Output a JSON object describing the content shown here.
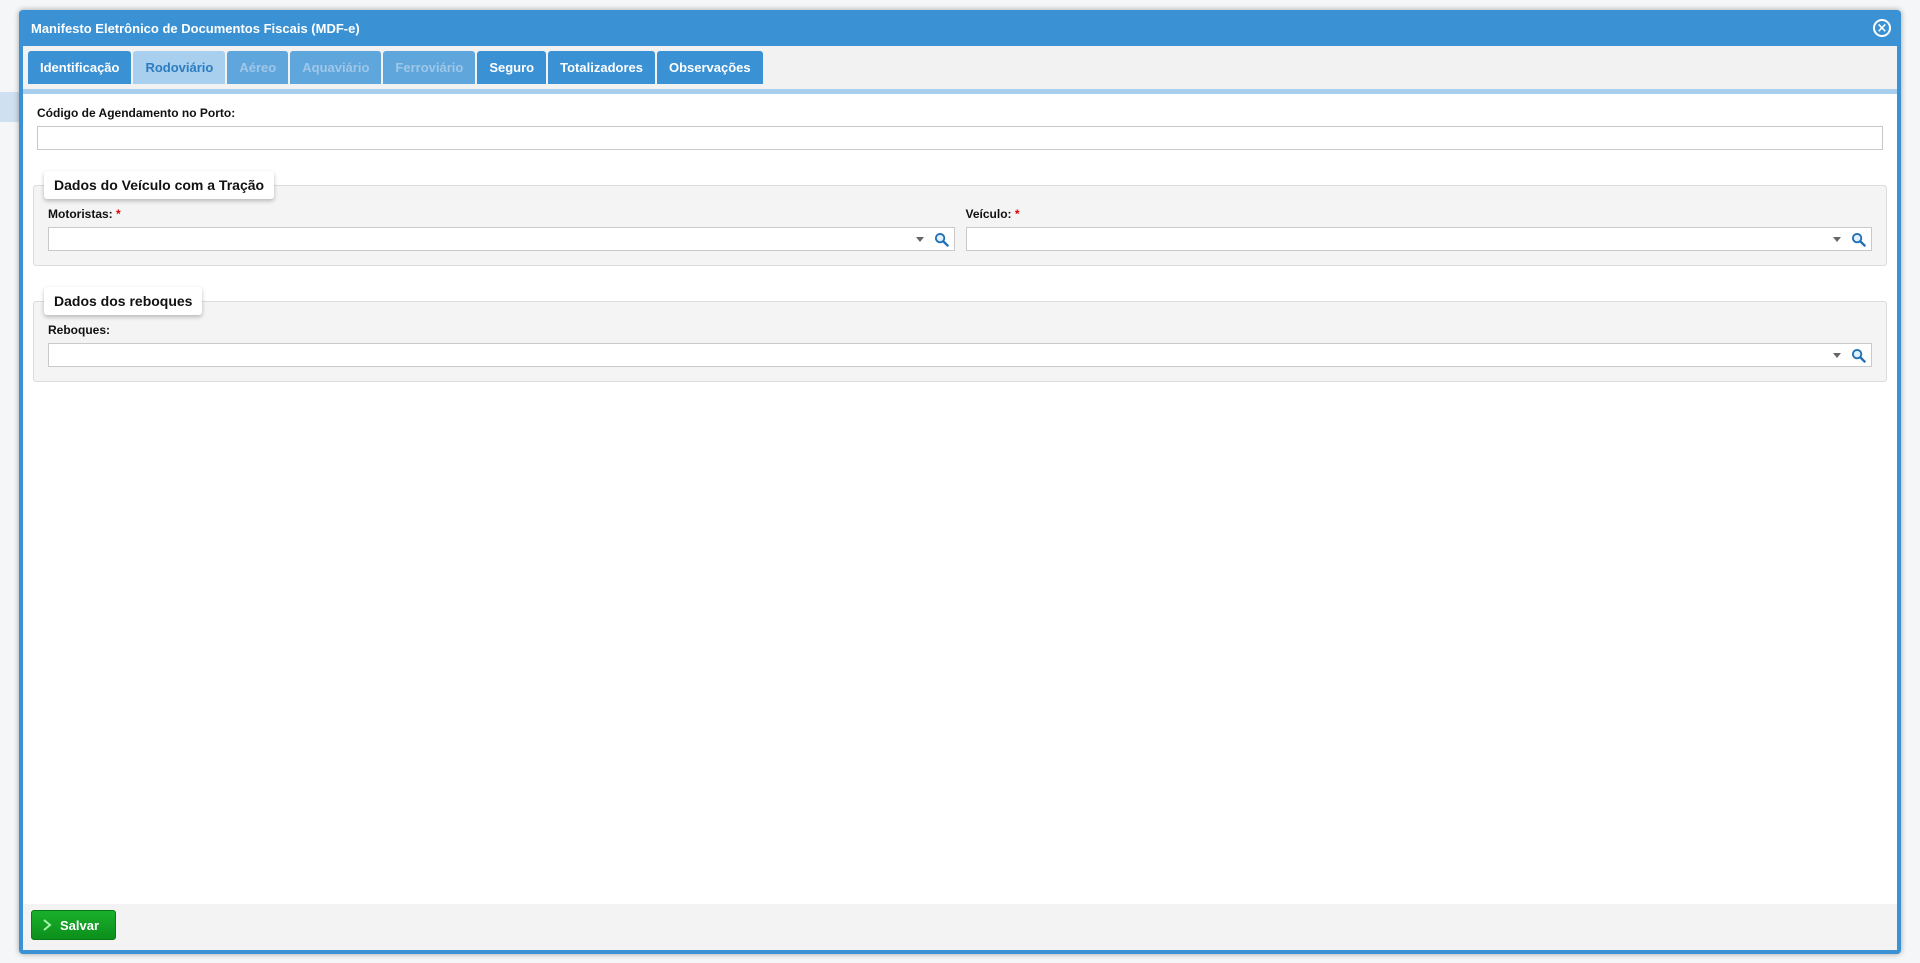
{
  "window": {
    "title": "Manifesto Eletrônico de Documentos Fiscais (MDF-e)",
    "close_symbol": "×"
  },
  "tabs": [
    {
      "label": "Identificação",
      "state": "normal"
    },
    {
      "label": "Rodoviário",
      "state": "active"
    },
    {
      "label": "Aéreo",
      "state": "disabled"
    },
    {
      "label": "Aquaviário",
      "state": "disabled"
    },
    {
      "label": "Ferroviário",
      "state": "disabled"
    },
    {
      "label": "Seguro",
      "state": "normal"
    },
    {
      "label": "Totalizadores",
      "state": "normal"
    },
    {
      "label": "Observações",
      "state": "normal"
    }
  ],
  "form": {
    "codigo_agendamento": {
      "label": "Código de Agendamento no Porto:",
      "value": ""
    },
    "veiculo_tracao": {
      "legend": "Dados do Veículo com a Tração",
      "motoristas": {
        "label": "Motoristas:",
        "required": "*",
        "value": ""
      },
      "veiculo": {
        "label": "Veículo:",
        "required": "*",
        "value": ""
      }
    },
    "reboques": {
      "legend": "Dados dos reboques",
      "reboques_field": {
        "label": "Reboques:",
        "value": ""
      }
    }
  },
  "footer": {
    "save_label": "Salvar"
  },
  "colors": {
    "window_blue": "#3a91d4",
    "active_tab": "#a9cfee",
    "save_green": "#1ab02b",
    "required_red": "#dd0000"
  },
  "icons": [
    "close-icon",
    "dropdown-arrow-icon",
    "search-icon",
    "chevron-right-icon"
  ]
}
